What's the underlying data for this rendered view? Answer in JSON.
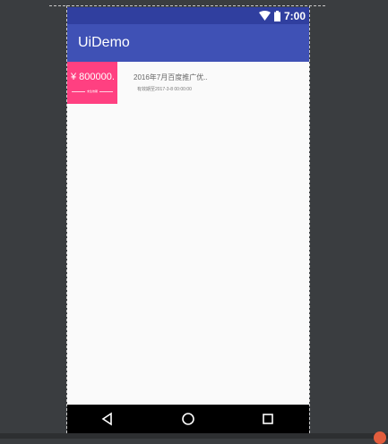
{
  "status_bar": {
    "time": "7:00",
    "icons": [
      "wifi-icon",
      "battery-icon"
    ],
    "color": "#303f9f"
  },
  "app_bar": {
    "title": "UiDemo",
    "color": "#3f51b5"
  },
  "coupon": {
    "amount": "¥ 800000.",
    "status_label": "未生效期",
    "title": "2016年7月百度推广优..",
    "expire": "有效期至2017-3-8 00:00:00",
    "accent_color": "#ff4081"
  },
  "nav_bar": {
    "buttons": [
      "back-icon",
      "home-icon",
      "recent-apps-icon"
    ]
  }
}
